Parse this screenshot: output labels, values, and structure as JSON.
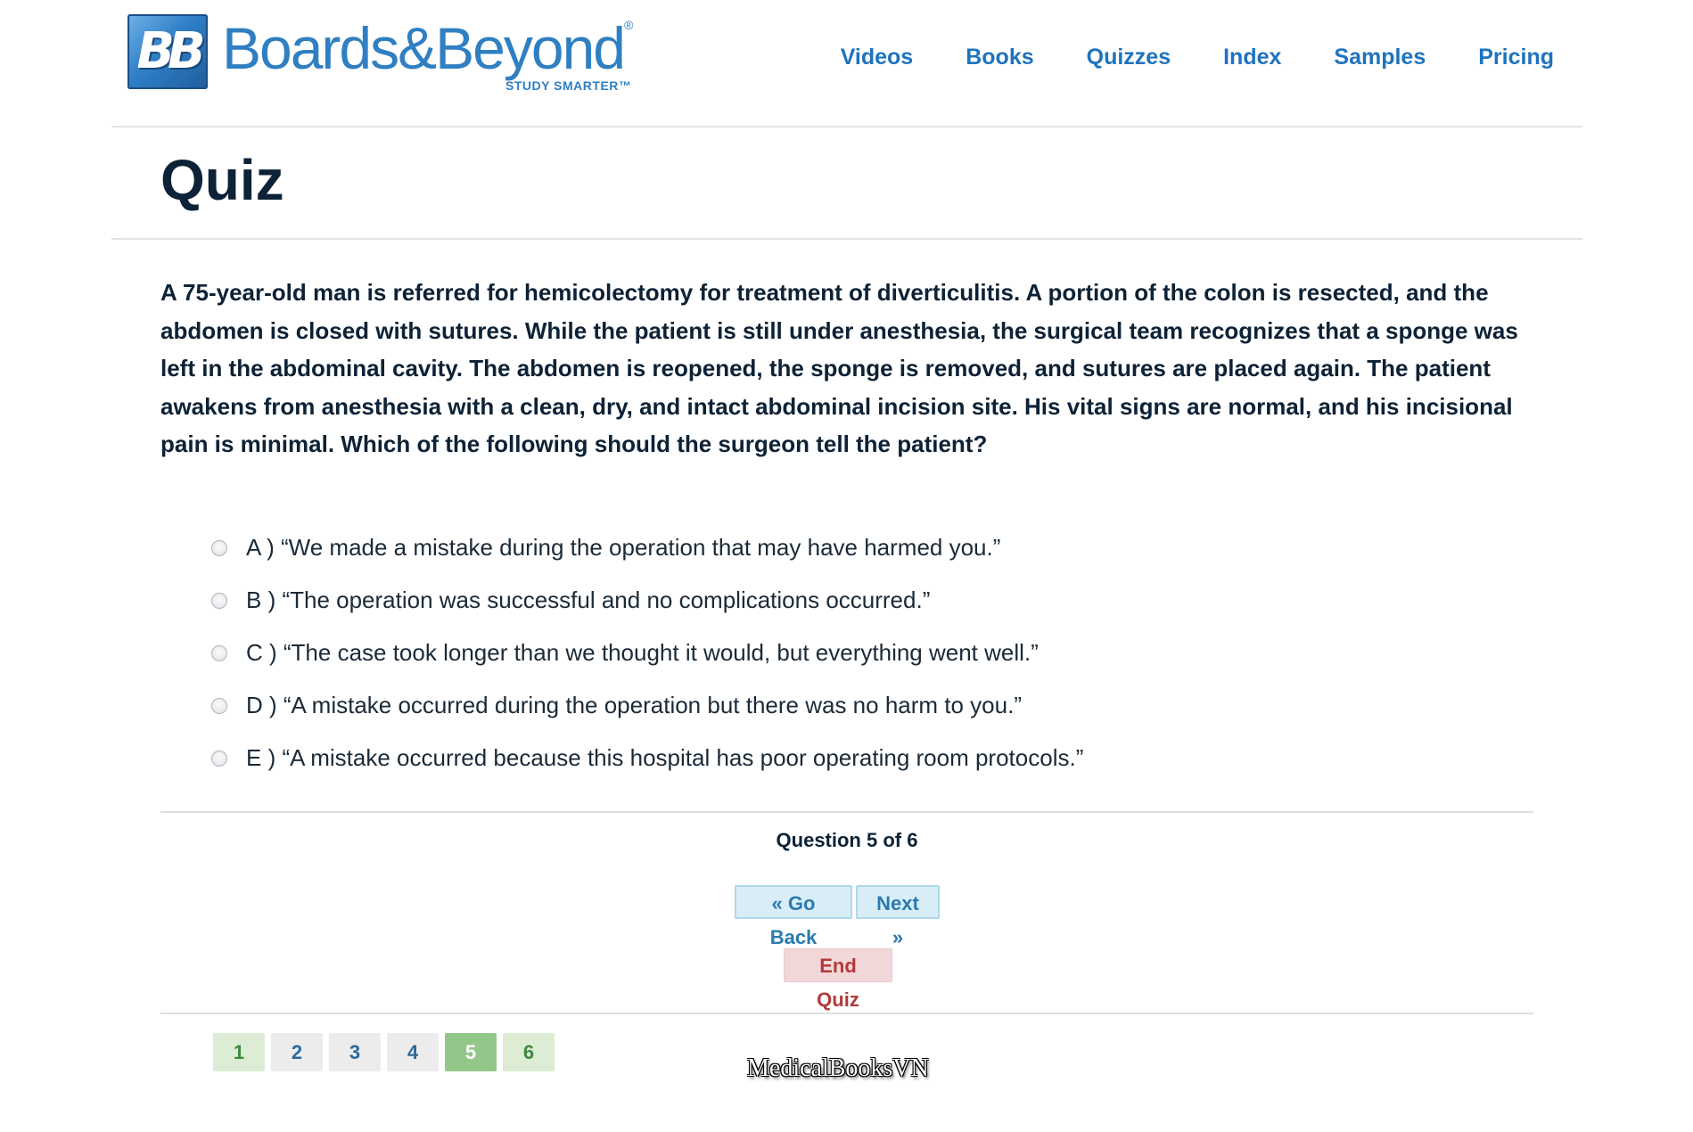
{
  "header": {
    "logo_mark": "BB",
    "logo_name": "Boards&Beyond",
    "logo_registered": "®",
    "logo_tagline": "STUDY SMARTER™",
    "nav": [
      {
        "label": "Videos"
      },
      {
        "label": "Books"
      },
      {
        "label": "Quizzes"
      },
      {
        "label": "Index"
      },
      {
        "label": "Samples"
      },
      {
        "label": "Pricing"
      }
    ]
  },
  "page": {
    "title": "Quiz"
  },
  "quiz": {
    "question": "A 75-year-old man is referred for hemicolectomy for treatment of diverticulitis. A portion of the colon is resected, and the abdomen is closed with sutures. While the patient is still under anesthesia, the surgical team recognizes that a sponge was left in the abdominal cavity. The abdomen is reopened, the sponge is removed, and sutures are placed again. The patient awakens from anesthesia with a clean, dry, and intact abdominal incision site. His vital signs are normal, and his incisional pain is minimal. Which of the following should the surgeon tell the patient?",
    "choices": [
      {
        "label": "A ) “We made a mistake during the operation that may have harmed you.”"
      },
      {
        "label": "B ) “The operation was successful and no complications occurred.”"
      },
      {
        "label": "C ) “The case took longer than we thought it would, but everything went well.”"
      },
      {
        "label": "D ) “A mistake occurred during the operation but there was no harm to you.”"
      },
      {
        "label": "E ) “A mistake occurred because this hospital has poor operating room protocols.”"
      }
    ],
    "question_counter": "Question 5 of 6",
    "go_back_label": "« Go Back",
    "next_label": "Next »",
    "end_quiz_label": "End Quiz",
    "pages": [
      {
        "label": "1",
        "status": "answered"
      },
      {
        "label": "2",
        "status": "unanswered"
      },
      {
        "label": "3",
        "status": "unanswered"
      },
      {
        "label": "4",
        "status": "unanswered"
      },
      {
        "label": "5",
        "status": "current"
      },
      {
        "label": "6",
        "status": "answered"
      }
    ]
  },
  "watermark": "MedicalBooksVN",
  "colors": {
    "brand_blue": "#1e73be",
    "heading": "#0d2236",
    "answered_bg": "#dcecd5",
    "current_bg": "#93c78a",
    "end_quiz_bg": "#f2d7d9"
  }
}
